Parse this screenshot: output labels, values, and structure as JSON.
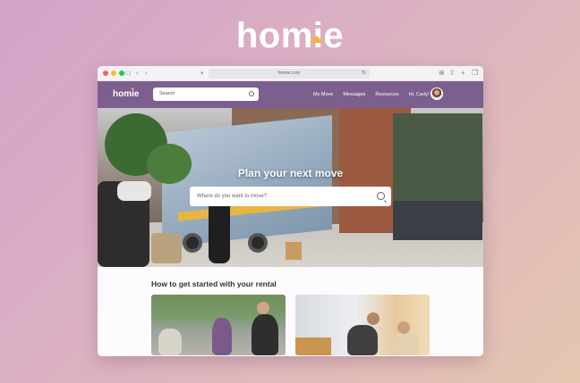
{
  "brand": {
    "logo_text": "homie",
    "accent": "#f2b33c"
  },
  "browser": {
    "url": "homie.com",
    "traffic_lights": [
      "#ff5f57",
      "#febc2e",
      "#28c840"
    ]
  },
  "navbar": {
    "logo": "homie",
    "search_placeholder": "Search",
    "links": [
      "My Move",
      "Messages",
      "Resources",
      "Hi, Carly!"
    ],
    "background": "#7c5f8e"
  },
  "hero": {
    "title": "Plan your next move",
    "search_placeholder": "Where do you want to move?"
  },
  "section": {
    "title": "How to get started with your rental"
  }
}
